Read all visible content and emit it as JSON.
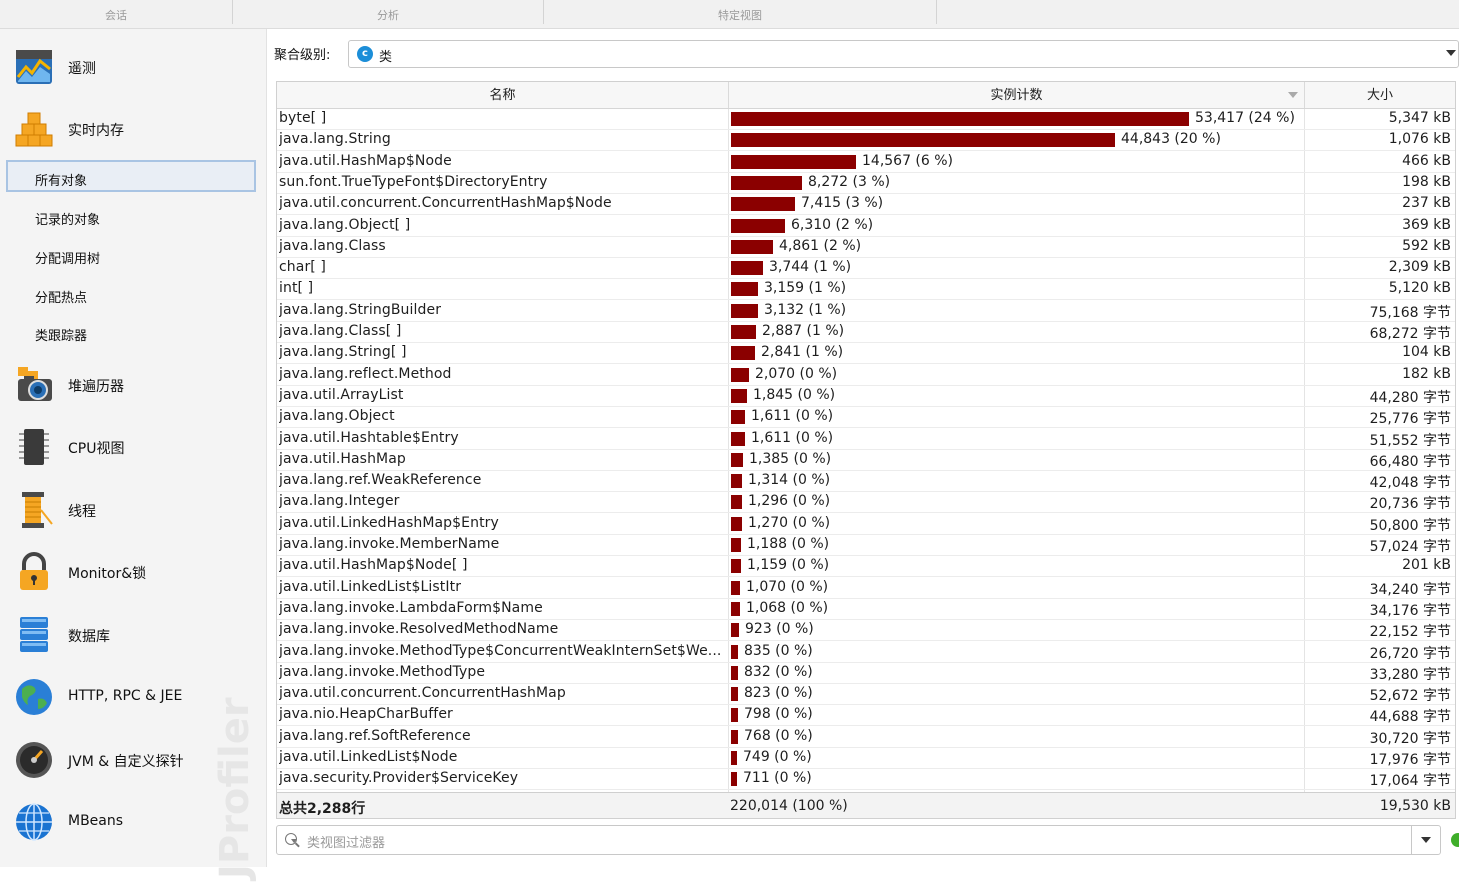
{
  "top_tabs": [
    "会话",
    "分析",
    "特定视图"
  ],
  "sidebar": {
    "main": [
      {
        "label": "遥测",
        "icon": "telemetry-icon"
      },
      {
        "label": "实时内存",
        "icon": "live-memory-icon"
      },
      {
        "label": "堆遍历器",
        "icon": "heap-walker-icon"
      },
      {
        "label": "CPU视图",
        "icon": "cpu-icon"
      },
      {
        "label": "线程",
        "icon": "threads-icon"
      },
      {
        "label": "Monitor&锁",
        "icon": "lock-icon"
      },
      {
        "label": "数据库",
        "icon": "database-icon"
      },
      {
        "label": "HTTP, RPC & JEE",
        "icon": "globe-icon"
      },
      {
        "label": "JVM & 自定义探针",
        "icon": "gauge-icon"
      },
      {
        "label": "MBeans",
        "icon": "mbeans-icon"
      }
    ],
    "sub": [
      "所有对象",
      "记录的对象",
      "分配调用树",
      "分配热点",
      "类跟踪器"
    ],
    "active_sub": "所有对象",
    "watermark": "JProfiler"
  },
  "aggregation": {
    "label": "聚合级别:",
    "icon_letter": "c",
    "value": "类"
  },
  "table": {
    "columns": [
      "名称",
      "实例计数",
      "大小"
    ],
    "bar_color": "#8b0000",
    "max_count": 53417,
    "rows": [
      {
        "name": "byte[ ]",
        "count": 53417,
        "count_label": "53,417 (24 %)",
        "size": "5,347 kB"
      },
      {
        "name": "java.lang.String",
        "count": 44843,
        "count_label": "44,843 (20 %)",
        "size": "1,076 kB"
      },
      {
        "name": "java.util.HashMap$Node",
        "count": 14567,
        "count_label": "14,567 (6 %)",
        "size": "466 kB"
      },
      {
        "name": "sun.font.TrueTypeFont$DirectoryEntry",
        "count": 8272,
        "count_label": "8,272 (3 %)",
        "size": "198 kB"
      },
      {
        "name": "java.util.concurrent.ConcurrentHashMap$Node",
        "count": 7415,
        "count_label": "7,415 (3 %)",
        "size": "237 kB"
      },
      {
        "name": "java.lang.Object[ ]",
        "count": 6310,
        "count_label": "6,310 (2 %)",
        "size": "369 kB"
      },
      {
        "name": "java.lang.Class",
        "count": 4861,
        "count_label": "4,861 (2 %)",
        "size": "592 kB"
      },
      {
        "name": "char[ ]",
        "count": 3744,
        "count_label": "3,744 (1 %)",
        "size": "2,309 kB"
      },
      {
        "name": "int[ ]",
        "count": 3159,
        "count_label": "3,159 (1 %)",
        "size": "5,120 kB"
      },
      {
        "name": "java.lang.StringBuilder",
        "count": 3132,
        "count_label": "3,132 (1 %)",
        "size": "75,168 字节"
      },
      {
        "name": "java.lang.Class[ ]",
        "count": 2887,
        "count_label": "2,887 (1 %)",
        "size": "68,272 字节"
      },
      {
        "name": "java.lang.String[ ]",
        "count": 2841,
        "count_label": "2,841 (1 %)",
        "size": "104 kB"
      },
      {
        "name": "java.lang.reflect.Method",
        "count": 2070,
        "count_label": "2,070 (0 %)",
        "size": "182 kB"
      },
      {
        "name": "java.util.ArrayList",
        "count": 1845,
        "count_label": "1,845 (0 %)",
        "size": "44,280 字节"
      },
      {
        "name": "java.lang.Object",
        "count": 1611,
        "count_label": "1,611 (0 %)",
        "size": "25,776 字节"
      },
      {
        "name": "java.util.Hashtable$Entry",
        "count": 1611,
        "count_label": "1,611 (0 %)",
        "size": "51,552 字节"
      },
      {
        "name": "java.util.HashMap",
        "count": 1385,
        "count_label": "1,385 (0 %)",
        "size": "66,480 字节"
      },
      {
        "name": "java.lang.ref.WeakReference",
        "count": 1314,
        "count_label": "1,314 (0 %)",
        "size": "42,048 字节"
      },
      {
        "name": "java.lang.Integer",
        "count": 1296,
        "count_label": "1,296 (0 %)",
        "size": "20,736 字节"
      },
      {
        "name": "java.util.LinkedHashMap$Entry",
        "count": 1270,
        "count_label": "1,270 (0 %)",
        "size": "50,800 字节"
      },
      {
        "name": "java.lang.invoke.MemberName",
        "count": 1188,
        "count_label": "1,188 (0 %)",
        "size": "57,024 字节"
      },
      {
        "name": "java.util.HashMap$Node[ ]",
        "count": 1159,
        "count_label": "1,159 (0 %)",
        "size": "201 kB"
      },
      {
        "name": "java.util.LinkedList$ListItr",
        "count": 1070,
        "count_label": "1,070 (0 %)",
        "size": "34,240 字节"
      },
      {
        "name": "java.lang.invoke.LambdaForm$Name",
        "count": 1068,
        "count_label": "1,068 (0 %)",
        "size": "34,176 字节"
      },
      {
        "name": "java.lang.invoke.ResolvedMethodName",
        "count": 923,
        "count_label": "923 (0 %)",
        "size": "22,152 字节"
      },
      {
        "name": "java.lang.invoke.MethodType$ConcurrentWeakInternSet$We...",
        "count": 835,
        "count_label": "835 (0 %)",
        "size": "26,720 字节"
      },
      {
        "name": "java.lang.invoke.MethodType",
        "count": 832,
        "count_label": "832 (0 %)",
        "size": "33,280 字节"
      },
      {
        "name": "java.util.concurrent.ConcurrentHashMap",
        "count": 823,
        "count_label": "823 (0 %)",
        "size": "52,672 字节"
      },
      {
        "name": "java.nio.HeapCharBuffer",
        "count": 798,
        "count_label": "798 (0 %)",
        "size": "44,688 字节"
      },
      {
        "name": "java.lang.ref.SoftReference",
        "count": 768,
        "count_label": "768 (0 %)",
        "size": "30,720 字节"
      },
      {
        "name": "java.util.LinkedList$Node",
        "count": 749,
        "count_label": "749 (0 %)",
        "size": "17,976 字节"
      },
      {
        "name": "java.security.Provider$ServiceKey",
        "count": 711,
        "count_label": "711 (0 %)",
        "size": "17,064 字节"
      }
    ],
    "footer": {
      "rows": "总共2,288行",
      "count": "220,014 (100 %)",
      "size": "19,530 kB"
    }
  },
  "filter": {
    "placeholder": "类视图过滤器"
  }
}
